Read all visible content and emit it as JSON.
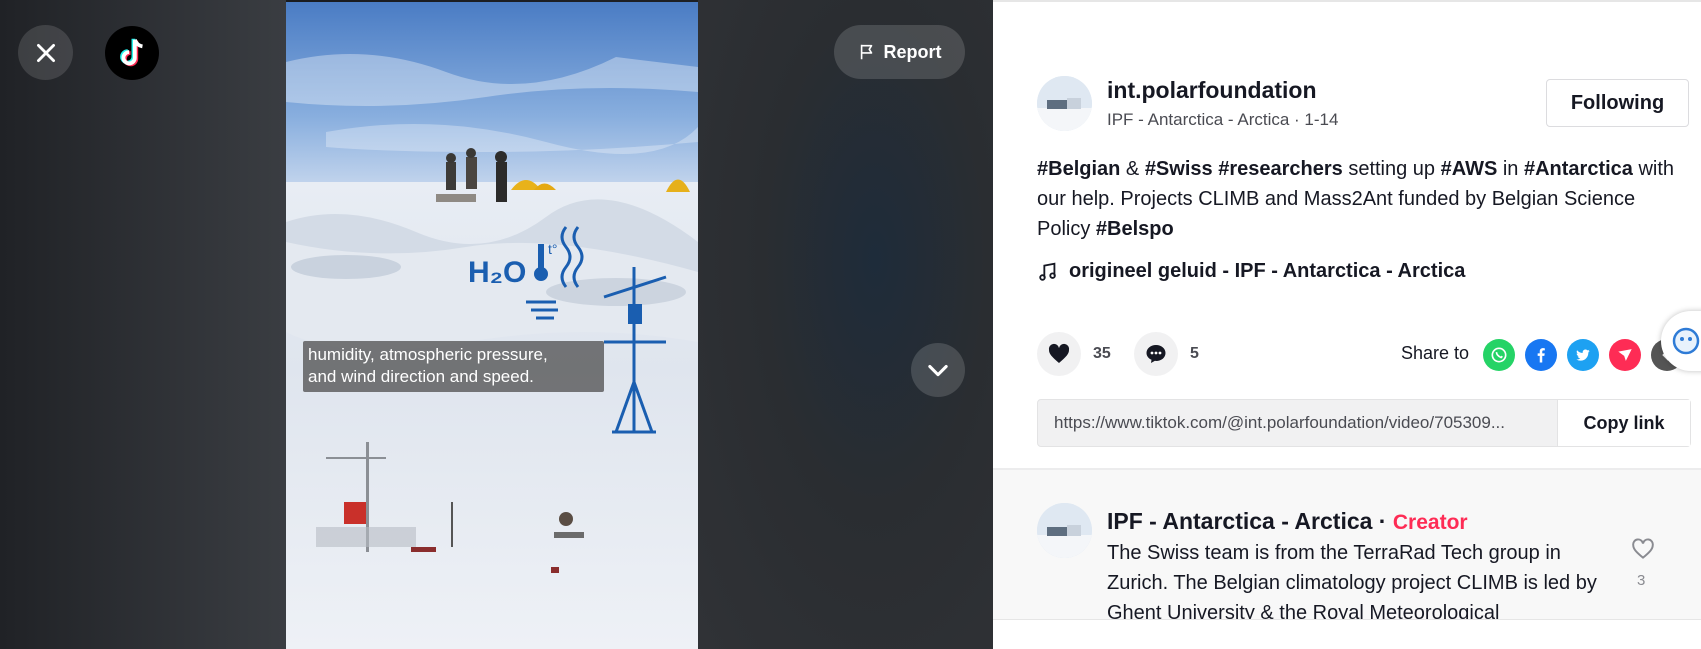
{
  "video": {
    "report_label": "Report",
    "caption_lines": [
      "humidity, atmospheric pressure,",
      "and wind direction and speed."
    ],
    "overlay_text": "H₂O",
    "overlay_temp_text": "t°"
  },
  "author": {
    "username": "int.polarfoundation",
    "subline": "IPF - Antarctica - Arctica · 1-14",
    "follow_label": "Following"
  },
  "description": {
    "segments": [
      {
        "text": "#Belgian",
        "tag": true
      },
      {
        "text": " & ",
        "tag": false
      },
      {
        "text": "#Swiss",
        "tag": true
      },
      {
        "text": " ",
        "tag": false
      },
      {
        "text": "#researchers",
        "tag": true
      },
      {
        "text": " setting up ",
        "tag": false
      },
      {
        "text": "#AWS",
        "tag": true
      },
      {
        "text": " in ",
        "tag": false
      },
      {
        "text": "#Antarctica",
        "tag": true
      },
      {
        "text": " with our help. Projects CLIMB and Mass2Ant funded by Belgian Science Policy ",
        "tag": false
      },
      {
        "text": "#Belspo",
        "tag": true
      }
    ]
  },
  "music": {
    "label": "origineel geluid - IPF - Antarctica - Arctica",
    "icon": "music-note-icon"
  },
  "actions": {
    "likes": "35",
    "comments": "5",
    "share_label": "Share to",
    "share_targets": [
      {
        "name": "whatsapp",
        "color": "#25D366"
      },
      {
        "name": "facebook",
        "color": "#1877F2"
      },
      {
        "name": "twitter",
        "color": "#1DA1F2"
      },
      {
        "name": "telegram",
        "color": "#FE2C55"
      },
      {
        "name": "more",
        "color": "#555555"
      }
    ]
  },
  "link": {
    "url": "https://www.tiktok.com/@int.polarfoundation/video/705309...",
    "copy_label": "Copy link"
  },
  "comment": {
    "author": "IPF - Antarctica - Arctica",
    "separator": " · ",
    "badge": "Creator",
    "text": "The Swiss team is from the TerraRad Tech group in Zurich. The Belgian climatology project CLIMB is led by Ghent University & the Royal Meteorological",
    "likes": "3"
  },
  "colors": {
    "accent": "#FE2C55",
    "overlay_blue": "#1a5eb0"
  }
}
